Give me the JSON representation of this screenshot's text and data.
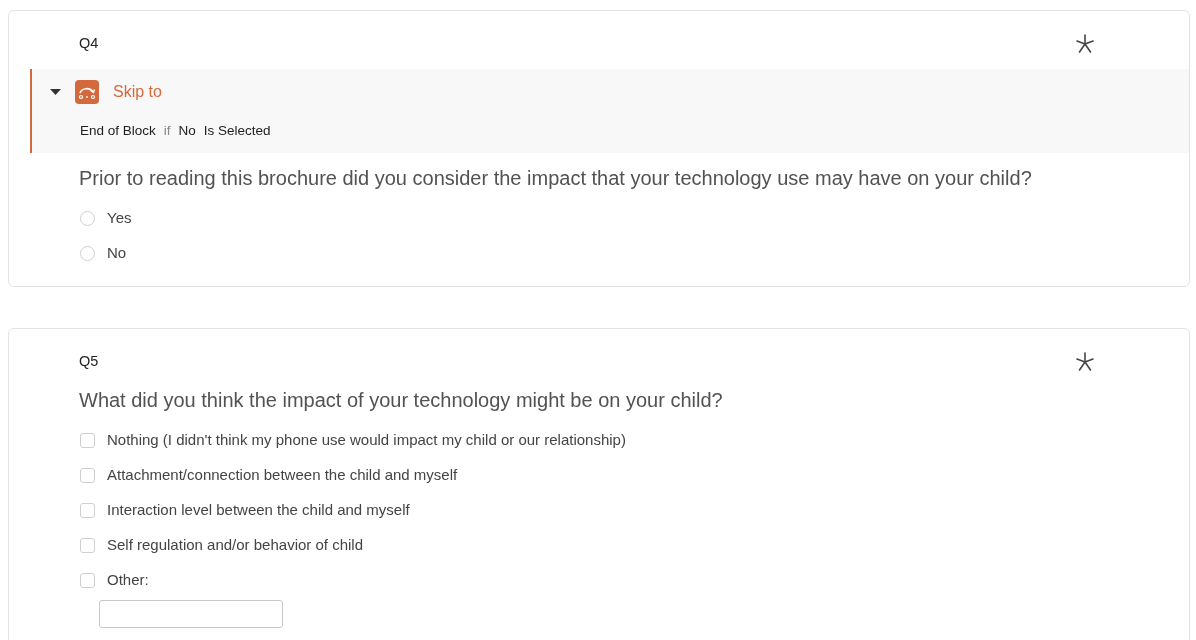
{
  "questions": [
    {
      "label": "Q4",
      "required": true,
      "skip_logic": {
        "title": "Skip to",
        "expanded": true,
        "condition": [
          {
            "text": "End of Block",
            "kind": "term"
          },
          {
            "text": "if",
            "kind": "keyword"
          },
          {
            "text": "No",
            "kind": "term"
          },
          {
            "text": "Is Selected",
            "kind": "term"
          }
        ]
      },
      "text": "Prior to reading this brochure did you consider the impact that your technology use may have on your child?",
      "kind": "radio",
      "choices": [
        {
          "label": "Yes",
          "selected": false
        },
        {
          "label": "No",
          "selected": false
        }
      ]
    },
    {
      "label": "Q5",
      "required": true,
      "text": "What did you think the impact of your technology might be on your child?",
      "kind": "checkbox",
      "choices": [
        {
          "label": "Nothing (I didn't think my phone use would impact my child or our relationship)",
          "selected": false
        },
        {
          "label": "Attachment/connection between the child and myself",
          "selected": false
        },
        {
          "label": "Interaction level between the child and myself",
          "selected": false
        },
        {
          "label": "Self regulation and/or behavior of child",
          "selected": false
        },
        {
          "label": "Other:",
          "selected": false,
          "text_entry": true
        }
      ]
    }
  ]
}
